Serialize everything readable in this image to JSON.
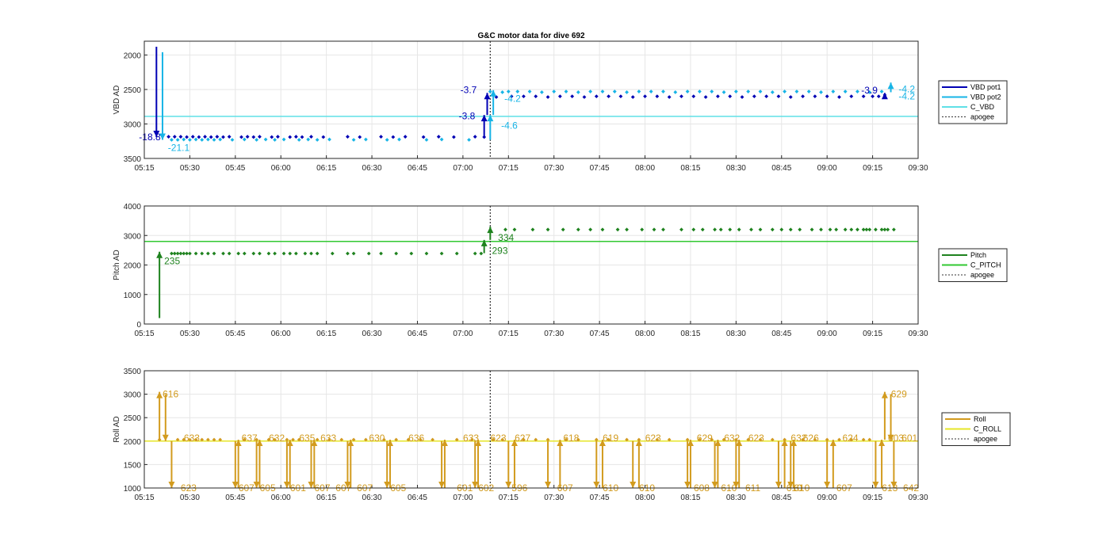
{
  "figure_title": "G&C motor data for dive 692",
  "chart_data": [
    {
      "type": "scatter",
      "ylabel": "VBD AD",
      "ylim": [
        3500,
        1800
      ],
      "y_reversed": true,
      "yticks": [
        2000,
        2500,
        3000,
        3500
      ],
      "xlim": [
        "05:15",
        "09:30"
      ],
      "xticks": [
        "05:15",
        "05:30",
        "05:45",
        "06:00",
        "06:15",
        "06:30",
        "06:45",
        "07:00",
        "07:15",
        "07:30",
        "07:45",
        "08:00",
        "08:15",
        "08:30",
        "08:45",
        "09:00",
        "09:15",
        "09:30"
      ],
      "grid": true,
      "legend_position": "right",
      "legend": [
        "VBD pot1",
        "VBD pot2",
        "C_VBD",
        "apogee"
      ],
      "apogee": "07:09",
      "series": [
        {
          "name": "VBD pot1",
          "color": "#0000b4",
          "type": "scatter",
          "x": [
            "05:23",
            "05:25",
            "05:27",
            "05:29",
            "05:31",
            "05:33",
            "05:35",
            "05:37",
            "05:39",
            "05:41",
            "05:43",
            "05:47",
            "05:49",
            "05:51",
            "05:53",
            "05:57",
            "05:59",
            "06:03",
            "06:05",
            "06:07",
            "06:10",
            "06:14",
            "06:22",
            "06:26",
            "06:33",
            "06:37",
            "06:41",
            "06:47",
            "06:52",
            "06:57",
            "07:04",
            "07:07",
            "07:11",
            "07:16",
            "07:20",
            "07:24",
            "07:28",
            "07:32",
            "07:36",
            "07:40",
            "07:44",
            "07:48",
            "07:52",
            "07:56",
            "08:00",
            "08:04",
            "08:08",
            "08:12",
            "08:16",
            "08:20",
            "08:24",
            "08:28",
            "08:32",
            "08:36",
            "08:40",
            "08:44",
            "08:48",
            "08:52",
            "08:56",
            "09:00",
            "09:04",
            "09:08",
            "09:12",
            "09:15",
            "09:17",
            "09:19"
          ],
          "values": [
            3185,
            3185,
            3185,
            3190,
            3185,
            3190,
            3185,
            3190,
            3185,
            3190,
            3185,
            3190,
            3185,
            3190,
            3185,
            3190,
            3185,
            3190,
            3185,
            3190,
            3185,
            3190,
            3185,
            3190,
            3185,
            3190,
            3185,
            3190,
            3185,
            3190,
            3185,
            3190,
            2610,
            2600,
            2600,
            2600,
            2610,
            2600,
            2600,
            2610,
            2600,
            2600,
            2600,
            2610,
            2600,
            2600,
            2610,
            2600,
            2600,
            2610,
            2600,
            2600,
            2610,
            2600,
            2600,
            2600,
            2610,
            2600,
            2600,
            2600,
            2610,
            2600,
            2600,
            2600,
            2600,
            2580
          ]
        },
        {
          "name": "VBD pot2",
          "color": "#17b4e6",
          "type": "scatter",
          "x": [
            "05:24",
            "05:26",
            "05:28",
            "05:30",
            "05:32",
            "05:34",
            "05:36",
            "05:38",
            "05:40",
            "05:44",
            "05:48",
            "05:52",
            "05:55",
            "05:58",
            "06:01",
            "06:06",
            "06:09",
            "06:12",
            "06:16",
            "06:24",
            "06:28",
            "06:35",
            "06:39",
            "06:48",
            "06:53",
            "07:02",
            "07:09",
            "07:13",
            "07:15",
            "07:18",
            "07:22",
            "07:26",
            "07:30",
            "07:34",
            "07:38",
            "07:42",
            "07:46",
            "07:50",
            "07:54",
            "07:58",
            "08:02",
            "08:06",
            "08:10",
            "08:14",
            "08:18",
            "08:22",
            "08:26",
            "08:30",
            "08:34",
            "08:38",
            "08:42",
            "08:46",
            "08:50",
            "08:54",
            "08:58",
            "09:02",
            "09:06",
            "09:10",
            "09:14",
            "09:18"
          ],
          "values": [
            3230,
            3230,
            3225,
            3230,
            3225,
            3230,
            3225,
            3230,
            3225,
            3230,
            3225,
            3230,
            3225,
            3230,
            3225,
            3230,
            3225,
            3230,
            3225,
            3230,
            3225,
            3230,
            3225,
            3230,
            3225,
            3230,
            2530,
            2540,
            2530,
            2530,
            2530,
            2540,
            2530,
            2530,
            2540,
            2530,
            2530,
            2530,
            2540,
            2530,
            2530,
            2530,
            2540,
            2530,
            2530,
            2530,
            2540,
            2530,
            2530,
            2530,
            2540,
            2530,
            2530,
            2530,
            2540,
            2530,
            2530,
            2530,
            2540,
            2530
          ]
        },
        {
          "name": "C_VBD",
          "color": "#5fe0e6",
          "type": "line",
          "value": 2890
        }
      ],
      "annotations": [
        {
          "text": "-18.8",
          "color": "#0000b4"
        },
        {
          "text": "-21.1",
          "color": "#17b4e6"
        },
        {
          "text": "-3.7",
          "color": "#0000b4"
        },
        {
          "text": "-3.8",
          "color": "#0000b4"
        },
        {
          "text": "-4.2",
          "color": "#17b4e6"
        },
        {
          "text": "-4.6",
          "color": "#17b4e6"
        },
        {
          "text": "-3.9",
          "color": "#0000b4"
        },
        {
          "text": "-4.2",
          "color": "#17b4e6"
        },
        {
          "text": "-4.2",
          "color": "#17b4e6"
        }
      ]
    },
    {
      "type": "scatter",
      "ylabel": "Pitch AD",
      "ylim": [
        0,
        4000
      ],
      "yticks": [
        0,
        1000,
        2000,
        3000,
        4000
      ],
      "xlim": [
        "05:15",
        "09:30"
      ],
      "xticks": [
        "05:15",
        "05:30",
        "05:45",
        "06:00",
        "06:15",
        "06:30",
        "06:45",
        "07:00",
        "07:15",
        "07:30",
        "07:45",
        "08:00",
        "08:15",
        "08:30",
        "08:45",
        "09:00",
        "09:15",
        "09:30"
      ],
      "grid": true,
      "legend_position": "right",
      "legend": [
        "Pitch",
        "C_PITCH",
        "apogee"
      ],
      "apogee": "07:09",
      "series": [
        {
          "name": "Pitch",
          "color": "#1e821e",
          "type": "scatter",
          "x": [
            "05:24",
            "05:25",
            "05:26",
            "05:27",
            "05:28",
            "05:29",
            "05:30",
            "05:32",
            "05:34",
            "05:36",
            "05:38",
            "05:41",
            "05:43",
            "05:46",
            "05:48",
            "05:51",
            "05:53",
            "05:56",
            "05:58",
            "06:01",
            "06:03",
            "06:05",
            "06:08",
            "06:10",
            "06:12",
            "06:17",
            "06:22",
            "06:24",
            "06:29",
            "06:33",
            "06:38",
            "06:43",
            "06:48",
            "06:53",
            "06:58",
            "07:04",
            "07:06",
            "07:14",
            "07:17",
            "07:23",
            "07:28",
            "07:33",
            "07:38",
            "07:42",
            "07:46",
            "07:51",
            "07:54",
            "07:59",
            "08:03",
            "08:06",
            "08:12",
            "08:16",
            "08:19",
            "08:23",
            "08:25",
            "08:28",
            "08:31",
            "08:35",
            "08:38",
            "08:42",
            "08:45",
            "08:48",
            "08:51",
            "08:55",
            "08:58",
            "09:01",
            "09:03",
            "09:06",
            "09:08",
            "09:10",
            "09:12",
            "09:13",
            "09:14",
            "09:16",
            "09:18",
            "09:19",
            "09:20",
            "09:22"
          ],
          "values": [
            2390,
            2390,
            2390,
            2390,
            2390,
            2390,
            2390,
            2390,
            2390,
            2390,
            2390,
            2390,
            2390,
            2390,
            2390,
            2390,
            2390,
            2390,
            2390,
            2390,
            2390,
            2390,
            2390,
            2390,
            2390,
            2390,
            2390,
            2390,
            2390,
            2390,
            2390,
            2390,
            2390,
            2390,
            2390,
            2390,
            2390,
            3200,
            3200,
            3200,
            3200,
            3200,
            3200,
            3200,
            3200,
            3200,
            3200,
            3200,
            3200,
            3200,
            3200,
            3200,
            3200,
            3200,
            3200,
            3200,
            3200,
            3200,
            3200,
            3200,
            3200,
            3200,
            3200,
            3200,
            3200,
            3200,
            3200,
            3200,
            3200,
            3200,
            3200,
            3200,
            3200,
            3200,
            3200,
            3200,
            3200,
            3200
          ]
        },
        {
          "name": "C_PITCH",
          "color": "#32c832",
          "type": "line",
          "value": 2800
        }
      ],
      "annotations": [
        {
          "text": "235",
          "color": "#1e821e"
        },
        {
          "text": "334",
          "color": "#1e821e"
        },
        {
          "text": "293",
          "color": "#1e821e"
        }
      ]
    },
    {
      "type": "scatter",
      "ylabel": "Roll AD",
      "ylim": [
        1000,
        3500
      ],
      "yticks": [
        1000,
        1500,
        2000,
        2500,
        3000,
        3500
      ],
      "xlim": [
        "05:15",
        "09:30"
      ],
      "xticks": [
        "05:15",
        "05:30",
        "05:45",
        "06:00",
        "06:15",
        "06:30",
        "06:45",
        "07:00",
        "07:15",
        "07:30",
        "07:45",
        "08:00",
        "08:15",
        "08:30",
        "08:45",
        "09:00",
        "09:15",
        "09:30"
      ],
      "grid": true,
      "legend_position": "right",
      "legend": [
        "Roll",
        "C_ROLL",
        "apogee"
      ],
      "apogee": "07:09",
      "series": [
        {
          "name": "Roll",
          "color": "#d29b1e",
          "type": "scatter",
          "x": [
            "05:20",
            "05:26",
            "05:28",
            "05:30",
            "05:32",
            "05:34",
            "05:36",
            "05:38",
            "05:40",
            "05:48",
            "05:52",
            "05:56",
            "05:58",
            "06:02",
            "06:04",
            "06:06",
            "06:12",
            "06:16",
            "06:20",
            "06:24",
            "06:28",
            "06:34",
            "06:38",
            "06:42",
            "06:46",
            "06:50",
            "06:58",
            "07:03",
            "07:10",
            "07:13",
            "07:20",
            "07:24",
            "07:28",
            "07:34",
            "07:38",
            "07:44",
            "07:48",
            "07:54",
            "07:58",
            "08:04",
            "08:08",
            "08:14",
            "08:18",
            "08:22",
            "08:26",
            "08:30",
            "08:34",
            "08:38",
            "08:42",
            "08:46",
            "08:52",
            "08:56",
            "09:00",
            "09:04",
            "09:08",
            "09:12",
            "09:14"
          ],
          "values": [
            2030,
            2030,
            2030,
            2030,
            2030,
            2030,
            2030,
            2030,
            2030,
            2030,
            2030,
            2030,
            2030,
            2030,
            2030,
            2030,
            2030,
            2030,
            2030,
            2030,
            2030,
            2030,
            2030,
            2030,
            2030,
            2030,
            2030,
            2030,
            2030,
            2030,
            2030,
            2030,
            2030,
            2030,
            2030,
            2030,
            2030,
            2030,
            2030,
            2030,
            2030,
            2030,
            2030,
            2030,
            2030,
            2030,
            2030,
            2030,
            2030,
            2030,
            2030,
            2030,
            2030,
            2030,
            2030,
            2030,
            2030
          ]
        },
        {
          "name": "C_ROLL",
          "color": "#e6e628",
          "type": "line",
          "value": 2000
        }
      ],
      "annotations": [
        "616",
        "633",
        "623",
        "637",
        "632",
        "635",
        "633",
        "630",
        "636",
        "633",
        "623",
        "627",
        "618",
        "619",
        "623",
        "629",
        "632",
        "623",
        "632",
        "626",
        "624",
        "629",
        "607",
        "607",
        "605",
        "607",
        "601",
        "607",
        "605",
        "601",
        "602",
        "596",
        "607",
        "610",
        "610",
        "608",
        "610",
        "611",
        "610",
        "610",
        "607",
        "613",
        "642",
        "601",
        "603"
      ]
    }
  ]
}
